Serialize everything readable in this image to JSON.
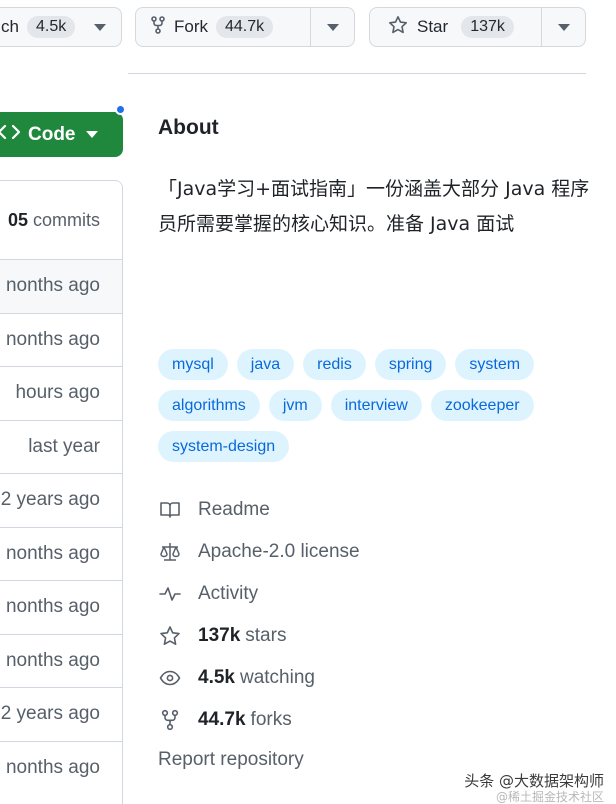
{
  "actions": {
    "watch": {
      "label": "ch",
      "count": "4.5k"
    },
    "fork": {
      "label": "Fork",
      "count": "44.7k"
    },
    "star": {
      "label": "Star",
      "count": "137k"
    }
  },
  "code_button": {
    "label": "Code"
  },
  "file_list": {
    "commits_count": "05",
    "commits_label": "commits",
    "rows": [
      "nonths ago",
      "nonths ago",
      "hours ago",
      "last year",
      "2 years ago",
      "nonths ago",
      "nonths ago",
      "nonths ago",
      "2 years ago",
      "nonths ago"
    ]
  },
  "about": {
    "title": "About",
    "description": "「Java学习+面试指南」一份涵盖大部分 Java 程序员所需要掌握的核心知识。准备 Java 面试",
    "topics": [
      "mysql",
      "java",
      "redis",
      "spring",
      "system",
      "algorithms",
      "jvm",
      "interview",
      "zookeeper",
      "system-design"
    ],
    "readme": "Readme",
    "license": "Apache-2.0 license",
    "activity": "Activity",
    "stars": {
      "count": "137k",
      "label": "stars"
    },
    "watching": {
      "count": "4.5k",
      "label": "watching"
    },
    "forks": {
      "count": "44.7k",
      "label": "forks"
    },
    "report": "Report repository"
  },
  "watermark": {
    "main": "头条 @大数据架构师",
    "sub": "@稀土掘金技术社区"
  },
  "colors": {
    "code_green": "#1f883d",
    "topic_bg": "#ddf4ff",
    "topic_text": "#0969da",
    "notification_dot": "#1f6feb"
  },
  "icons": [
    "eye-icon",
    "repo-forked-icon",
    "star-icon",
    "code-icon",
    "book-icon",
    "law-icon",
    "pulse-icon"
  ]
}
